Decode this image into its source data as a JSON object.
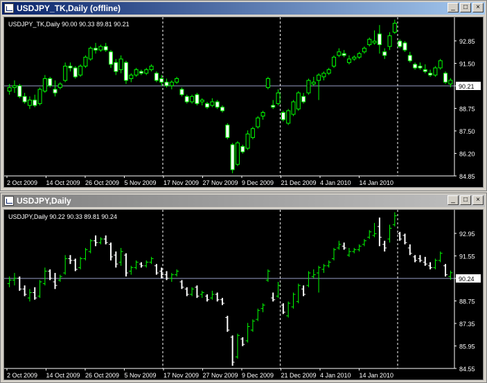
{
  "windows": [
    {
      "title": "USDJPY_TK,Daily  (offline)",
      "active": true,
      "info": "USDJPY_TK,Daily  90.00 90.33 89.81 90.21",
      "yticks": [
        "92.85",
        "91.50",
        "90.21",
        "88.75",
        "87.50",
        "86.20",
        "84.85"
      ],
      "price_label": "90.21",
      "style": "candles"
    },
    {
      "title": "USDJPY,Daily",
      "active": false,
      "info": "USDJPY,Daily  90.22 90.33 89.81 90.24",
      "yticks": [
        "92.95",
        "91.55",
        "90.24",
        "88.75",
        "87.35",
        "85.95",
        "84.55"
      ],
      "price_label": "90.24",
      "style": "bars"
    }
  ],
  "buttons": {
    "minimize": "_",
    "maximize": "□",
    "close": "×"
  },
  "xticks": [
    "2 Oct 2009",
    "14 Oct 2009",
    "26 Oct 2009",
    "5 Nov 2009",
    "17 Nov 2009",
    "27 Nov 2009",
    "9 Dec 2009",
    "21 Dec 2009",
    "4 Jan 2010",
    "14 Jan 2010"
  ],
  "colors": {
    "bull": "#00ff00",
    "bear": "#ffffff",
    "grid": "#ffffff",
    "bg": "#000000",
    "text": "#ffffff"
  },
  "chart_data": {
    "type": "candlestick",
    "symbol": "USDJPY",
    "timeframe": "Daily",
    "ylim": [
      84.85,
      93.5
    ],
    "separators_at_tick": [
      2,
      5,
      8
    ],
    "ohlc": [
      [
        89.6,
        90.0,
        89.4,
        89.8
      ],
      [
        89.8,
        90.2,
        89.5,
        89.9
      ],
      [
        89.9,
        90.0,
        89.2,
        89.3
      ],
      [
        89.3,
        89.5,
        88.9,
        89.0
      ],
      [
        88.8,
        89.3,
        88.6,
        89.1
      ],
      [
        89.1,
        89.4,
        88.7,
        88.8
      ],
      [
        88.9,
        89.8,
        88.8,
        89.7
      ],
      [
        89.6,
        90.5,
        89.5,
        90.3
      ],
      [
        90.3,
        90.4,
        89.8,
        89.9
      ],
      [
        89.7,
        90.2,
        89.3,
        89.5
      ],
      [
        89.8,
        90.1,
        89.7,
        90.0
      ],
      [
        90.2,
        91.2,
        90.1,
        91.0
      ],
      [
        91.0,
        91.2,
        90.7,
        90.9
      ],
      [
        90.9,
        91.0,
        90.3,
        90.4
      ],
      [
        90.5,
        91.1,
        90.4,
        91.0
      ],
      [
        91.0,
        91.6,
        90.9,
        91.5
      ],
      [
        91.4,
        92.1,
        91.3,
        92.0
      ],
      [
        92.0,
        92.3,
        91.7,
        91.9
      ],
      [
        91.9,
        92.2,
        91.8,
        92.1
      ],
      [
        92.1,
        92.3,
        91.8,
        91.9
      ],
      [
        91.8,
        91.9,
        90.9,
        91.1
      ],
      [
        91.2,
        91.4,
        90.5,
        90.7
      ],
      [
        90.8,
        91.6,
        90.6,
        91.4
      ],
      [
        91.2,
        91.3,
        90.0,
        90.2
      ],
      [
        90.3,
        90.6,
        90.1,
        90.5
      ],
      [
        90.5,
        90.9,
        90.4,
        90.8
      ],
      [
        90.7,
        90.8,
        90.5,
        90.6
      ],
      [
        90.6,
        90.9,
        90.5,
        90.8
      ],
      [
        90.8,
        91.1,
        90.7,
        91.0
      ],
      [
        90.6,
        90.7,
        90.1,
        90.2
      ],
      [
        90.3,
        90.5,
        89.9,
        90.1
      ],
      [
        90.1,
        90.3,
        89.8,
        89.9
      ],
      [
        89.9,
        90.2,
        89.7,
        90.1
      ],
      [
        90.1,
        90.4,
        90.0,
        90.3
      ],
      [
        89.7,
        89.8,
        89.3,
        89.4
      ],
      [
        89.3,
        89.4,
        88.9,
        89.0
      ],
      [
        89.0,
        89.4,
        88.9,
        89.3
      ],
      [
        89.4,
        89.5,
        88.8,
        88.9
      ],
      [
        89.0,
        89.2,
        88.8,
        89.1
      ],
      [
        88.9,
        89.0,
        88.6,
        88.7
      ],
      [
        88.8,
        89.2,
        88.7,
        89.0
      ],
      [
        89.0,
        89.1,
        88.6,
        88.7
      ],
      [
        88.7,
        88.8,
        88.4,
        88.5
      ],
      [
        87.7,
        87.8,
        86.9,
        87.0
      ],
      [
        86.6,
        86.7,
        85.0,
        85.2
      ],
      [
        85.5,
        86.8,
        85.4,
        86.7
      ],
      [
        86.5,
        86.6,
        86.1,
        86.2
      ],
      [
        86.4,
        87.4,
        86.3,
        87.2
      ],
      [
        87.0,
        87.6,
        86.9,
        87.5
      ],
      [
        87.6,
        88.2,
        87.5,
        88.1
      ],
      [
        88.2,
        88.5,
        88.0,
        88.4
      ],
      [
        89.8,
        90.4,
        89.7,
        90.3
      ],
      [
        88.8,
        89.1,
        88.6,
        88.7
      ],
      [
        88.9,
        89.7,
        88.8,
        89.5
      ],
      [
        88.4,
        88.5,
        87.9,
        88.0
      ],
      [
        87.8,
        88.6,
        87.7,
        88.5
      ],
      [
        88.3,
        89.1,
        88.2,
        89.0
      ],
      [
        88.6,
        89.6,
        88.5,
        89.5
      ],
      [
        89.3,
        89.5,
        88.9,
        89.0
      ],
      [
        89.5,
        90.3,
        89.4,
        90.2
      ],
      [
        90.0,
        90.4,
        89.9,
        90.1
      ],
      [
        90.2,
        90.6,
        89.1,
        90.5
      ],
      [
        90.4,
        90.7,
        90.2,
        90.6
      ],
      [
        90.6,
        90.9,
        90.5,
        90.8
      ],
      [
        91.0,
        91.6,
        90.9,
        91.5
      ],
      [
        91.6,
        92.0,
        91.5,
        91.8
      ],
      [
        91.7,
        91.9,
        91.5,
        91.6
      ],
      [
        91.2,
        91.6,
        91.1,
        91.4
      ],
      [
        91.4,
        91.6,
        91.3,
        91.5
      ],
      [
        91.5,
        91.8,
        91.4,
        91.7
      ],
      [
        91.8,
        92.1,
        91.7,
        92.0
      ],
      [
        92.2,
        92.6,
        92.1,
        92.5
      ],
      [
        92.3,
        93.0,
        92.2,
        92.4
      ],
      [
        92.8,
        93.3,
        91.7,
        92.2
      ],
      [
        91.8,
        92.0,
        91.4,
        91.6
      ],
      [
        92.1,
        92.9,
        91.9,
        92.7
      ],
      [
        92.9,
        93.6,
        92.8,
        93.4
      ],
      [
        92.4,
        92.5,
        92.0,
        92.1
      ],
      [
        92.3,
        92.4,
        91.8,
        91.9
      ],
      [
        91.6,
        91.8,
        91.2,
        91.3
      ],
      [
        91.1,
        91.2,
        90.8,
        90.9
      ],
      [
        91.0,
        91.2,
        90.8,
        90.9
      ],
      [
        90.8,
        91.1,
        90.6,
        90.7
      ],
      [
        90.6,
        90.8,
        90.4,
        90.5
      ],
      [
        90.5,
        91.0,
        90.4,
        90.9
      ],
      [
        90.9,
        91.4,
        90.8,
        91.3
      ],
      [
        90.6,
        90.7,
        90.0,
        90.1
      ],
      [
        90.0,
        90.33,
        89.81,
        90.21
      ]
    ]
  }
}
